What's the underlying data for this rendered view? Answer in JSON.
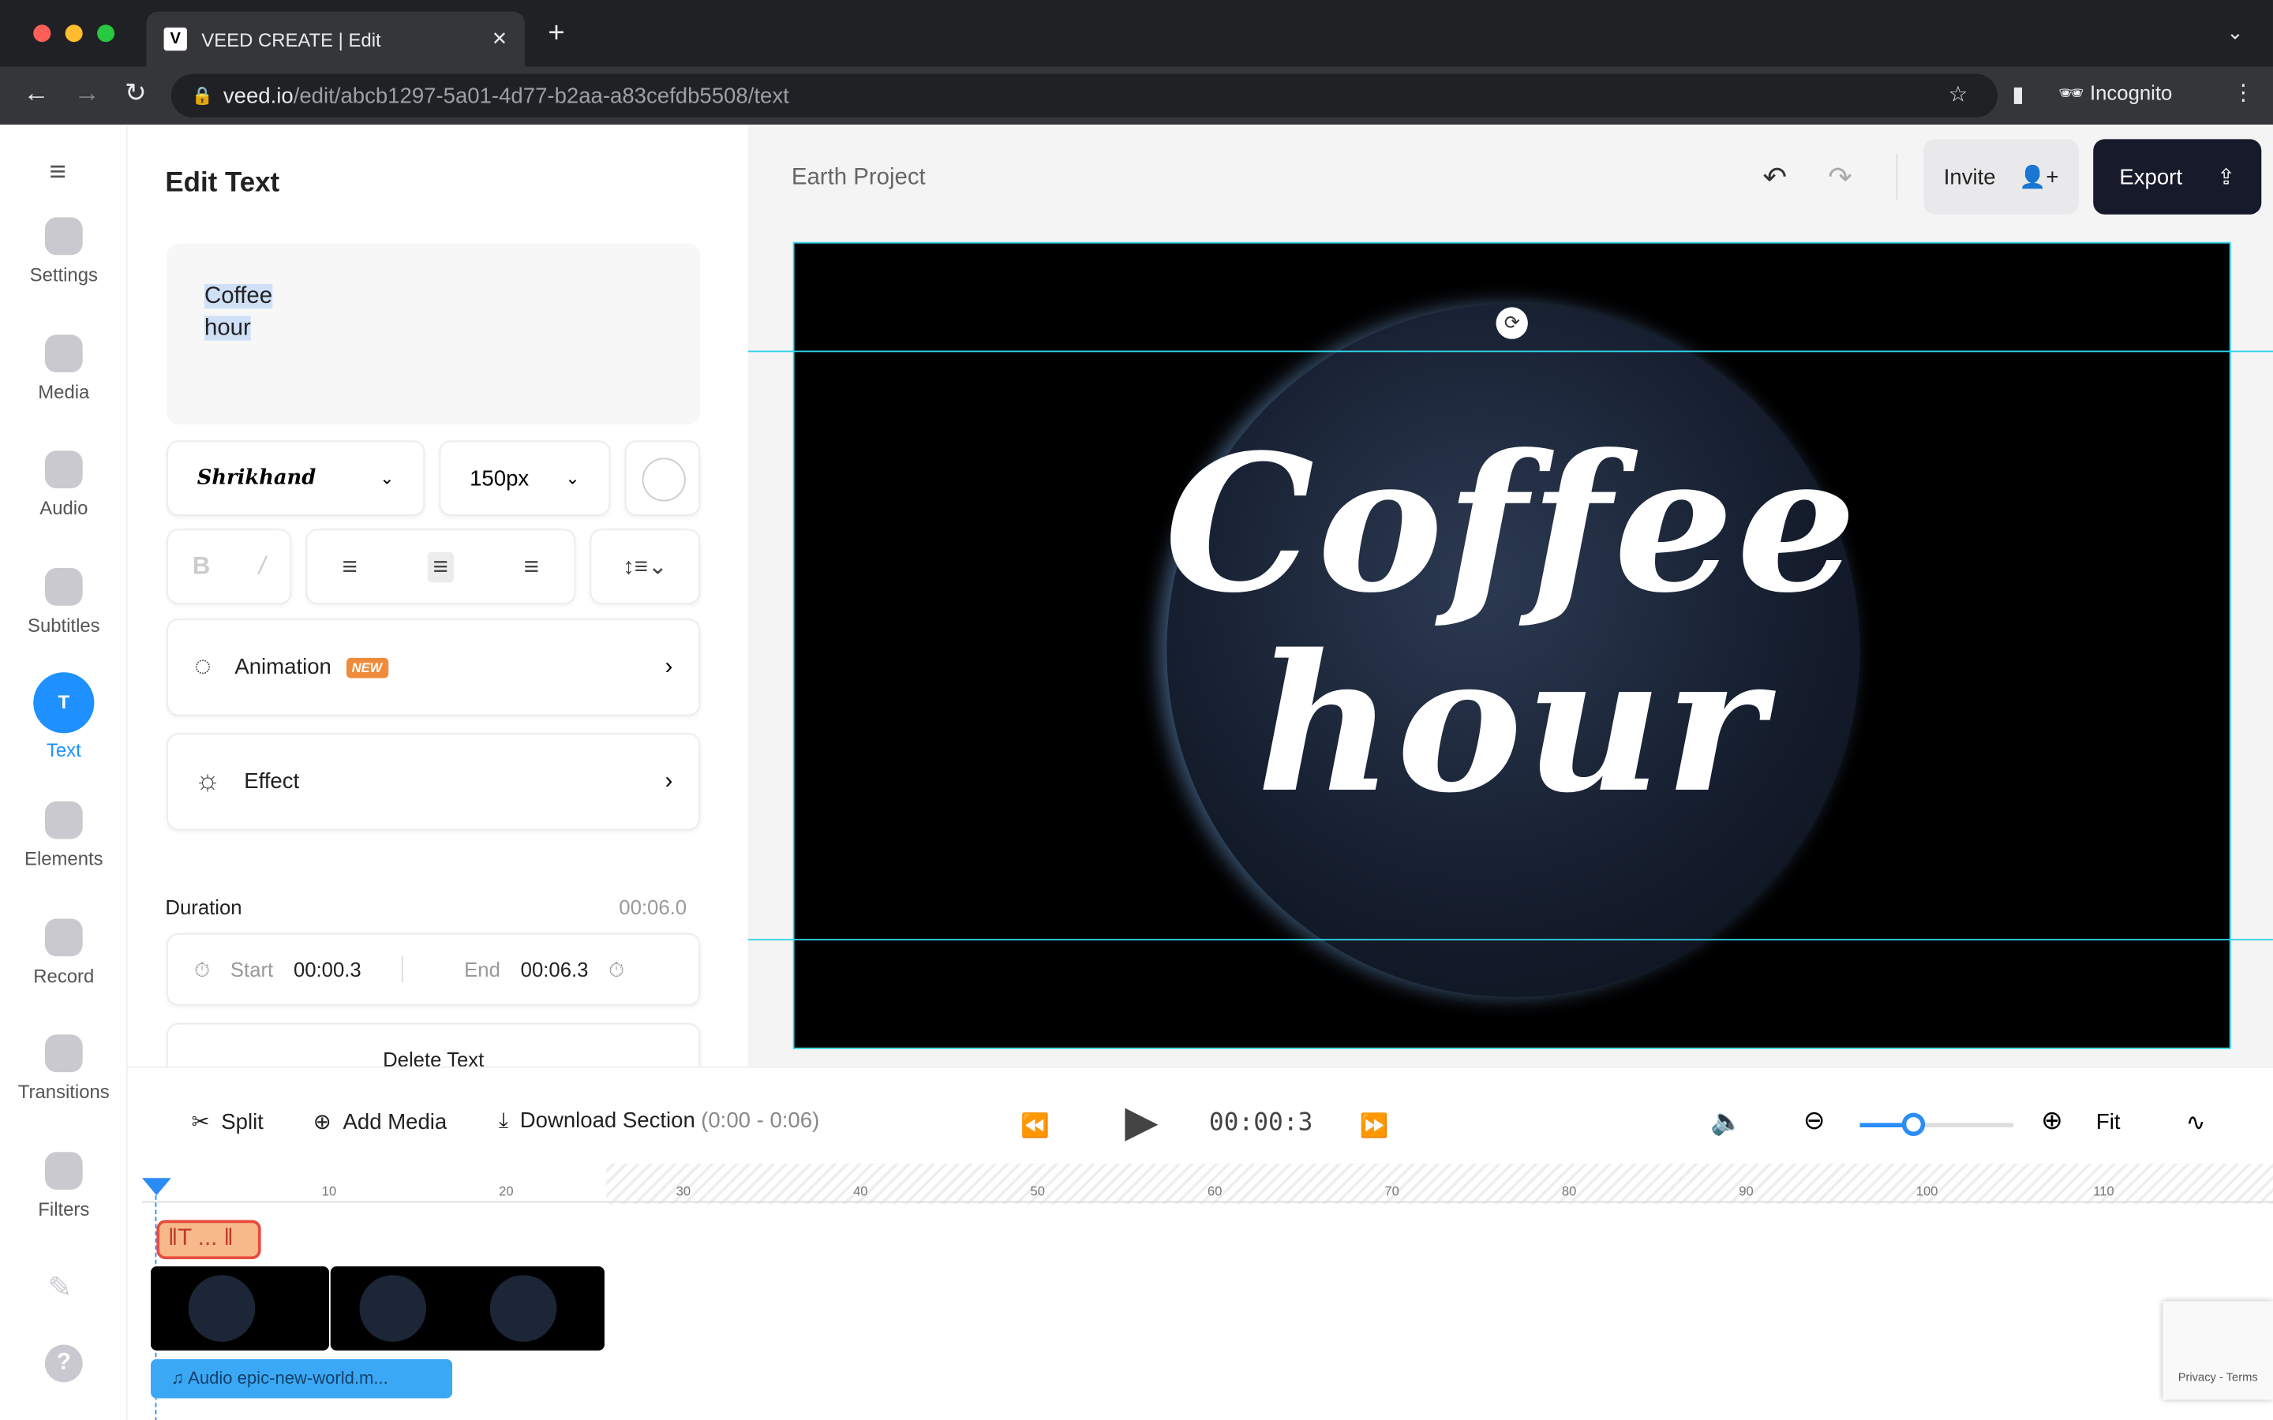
{
  "browser": {
    "tab_title": "VEED CREATE | Edit",
    "url_host": "veed.io",
    "url_path": "/edit/abcb1297-5a01-4d77-b2aa-a83cefdb5508/text",
    "profile": "Incognito"
  },
  "sidebar": {
    "items": [
      {
        "label": "Settings",
        "icon": "settings-icon"
      },
      {
        "label": "Media",
        "icon": "plus-icon"
      },
      {
        "label": "Audio",
        "icon": "music-note-icon"
      },
      {
        "label": "Subtitles",
        "icon": "subtitles-icon"
      },
      {
        "label": "Text",
        "icon": "text-icon",
        "active": true
      },
      {
        "label": "Elements",
        "icon": "elements-icon"
      },
      {
        "label": "Record",
        "icon": "camera-icon"
      },
      {
        "label": "Transitions",
        "icon": "transitions-icon"
      },
      {
        "label": "Filters",
        "icon": "filters-icon"
      }
    ],
    "accent": "#1e90ff"
  },
  "panel": {
    "title": "Edit Text",
    "text_line1": "Coffee",
    "text_line2": "hour",
    "font": "Shrikhand",
    "size": "150px",
    "animation_label": "Animation",
    "new_badge": "NEW",
    "effect_label": "Effect",
    "duration_label": "Duration",
    "duration_value": "00:06.0",
    "start_label": "Start",
    "start_value": "00:00.3",
    "end_label": "End",
    "end_value": "00:06.3",
    "delete_label": "Delete Text"
  },
  "stage": {
    "project_name": "Earth Project",
    "invite_label": "Invite",
    "export_label": "Export",
    "caption_line1": "Coffee",
    "caption_line2": "hour"
  },
  "timeline": {
    "split_label": "Split",
    "add_media_label": "Add Media",
    "download_label": "Download Section",
    "download_range": "(0:00 - 0:06)",
    "current_time": "00:00:3",
    "fit_label": "Fit",
    "zoom_level": 0.35,
    "ticks": [
      "10",
      "20",
      "30",
      "40",
      "50",
      "60",
      "70",
      "80",
      "90",
      "100",
      "110"
    ],
    "text_clip": "T ...",
    "audio_clip": "Audio epic-new-world.m..."
  },
  "recaptcha": {
    "text": "Privacy - Terms"
  }
}
